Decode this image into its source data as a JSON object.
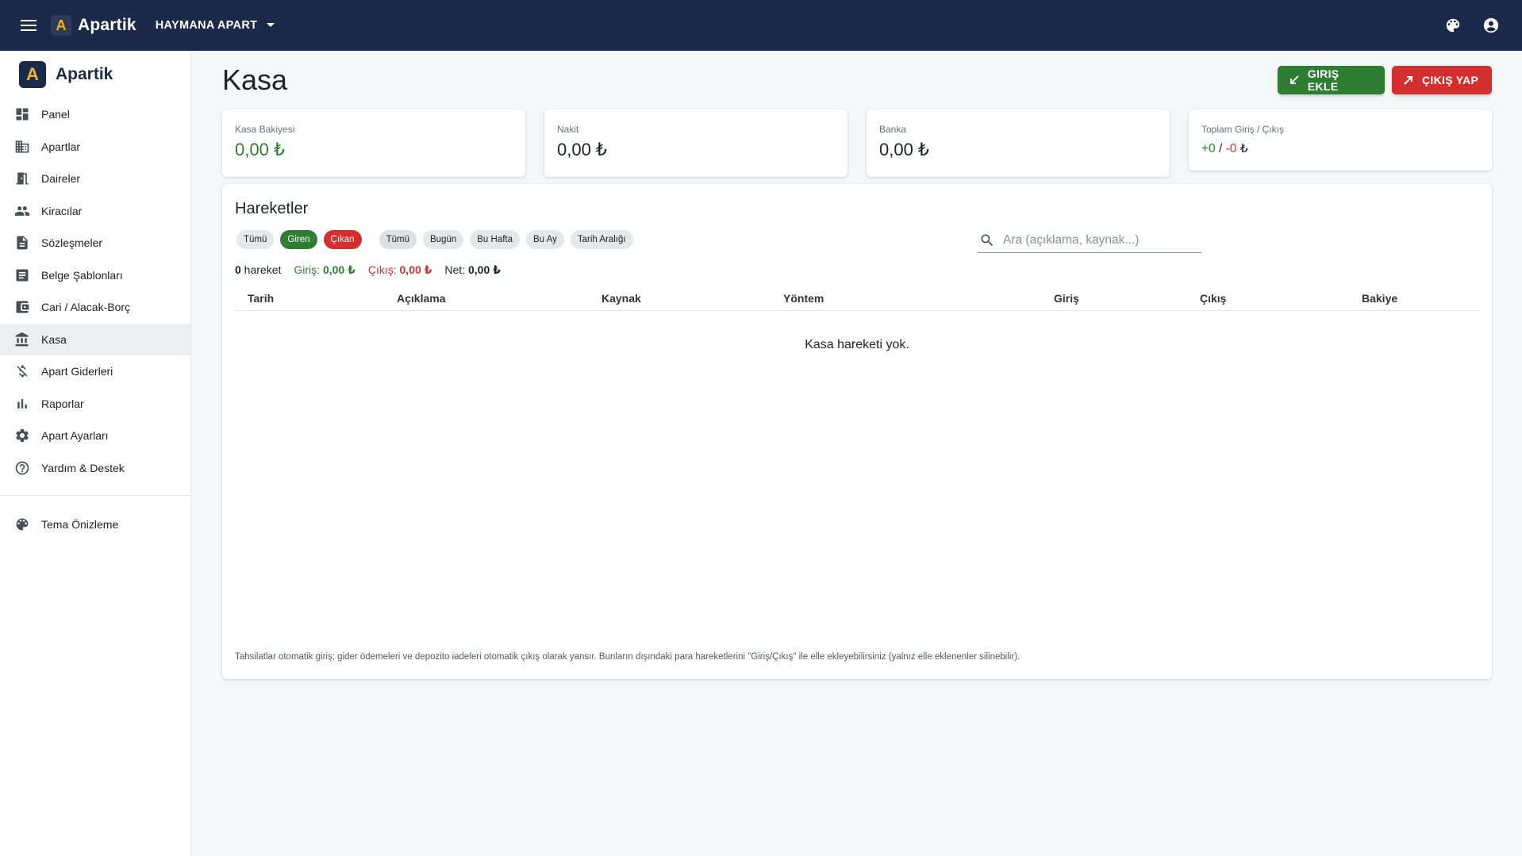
{
  "topbar": {
    "logo_letter": "A",
    "brand": "Apartik",
    "apart_name": "HAYMANA APART"
  },
  "sidebar": {
    "logo_letter": "A",
    "brand": "Apartik",
    "items": [
      {
        "label": "Panel",
        "icon": "dashboard-icon"
      },
      {
        "label": "Apartlar",
        "icon": "building-icon"
      },
      {
        "label": "Daireler",
        "icon": "door-icon"
      },
      {
        "label": "Kiracılar",
        "icon": "people-icon"
      },
      {
        "label": "Sözleşmeler",
        "icon": "document-icon"
      },
      {
        "label": "Belge Şablonları",
        "icon": "template-icon"
      },
      {
        "label": "Cari / Alacak-Borç",
        "icon": "wallet-icon"
      },
      {
        "label": "Kasa",
        "icon": "bank-icon"
      },
      {
        "label": "Apart Giderleri",
        "icon": "money-off-icon"
      },
      {
        "label": "Raporlar",
        "icon": "bar-chart-icon"
      },
      {
        "label": "Apart Ayarları",
        "icon": "gear-icon"
      },
      {
        "label": "Yardım & Destek",
        "icon": "help-icon"
      }
    ],
    "theme_preview": "Tema Önizleme",
    "active_index": 7
  },
  "page": {
    "title": "Kasa",
    "btn_in": "GIRIŞ EKLE",
    "btn_out": "ÇIKIŞ YAP"
  },
  "stats": {
    "kasa": {
      "label": "Kasa Bakiyesi",
      "value": "0,00 ₺"
    },
    "nakit": {
      "label": "Nakit",
      "value": "0,00 ₺"
    },
    "banka": {
      "label": "Banka",
      "value": "0,00 ₺"
    },
    "toplam": {
      "label": "Toplam Giriş / Çıkış",
      "in": "+0",
      "sep": " / ",
      "out": "-0",
      "currency": " ₺"
    }
  },
  "movements": {
    "title": "Hareketler",
    "type_chips": [
      "Tümü",
      "Giren",
      "Çıkan"
    ],
    "period_chips": [
      "Tümü",
      "Bugün",
      "Bu Hafta",
      "Bu Ay",
      "Tarih Aralığı"
    ],
    "search_placeholder": "Ara (açıklama, kaynak...)",
    "summary": {
      "count": "0",
      "count_label": " hareket",
      "in_label": "Giriş: ",
      "in_value": "0,00 ₺",
      "out_label": "Çıkış: ",
      "out_value": "0,00 ₺",
      "net_label": "Net: ",
      "net_value": "0,00 ₺"
    },
    "columns": [
      "Tarih",
      "Açıklama",
      "Kaynak",
      "Yöntem",
      "Giriş",
      "Çıkış",
      "Bakiye"
    ],
    "empty_text": "Kasa hareketi yok.",
    "footnote": "Tahsilatlar otomatik giriş; gider ödemeleri ve depozito iadeleri otomatik çıkış olarak yansır. Bunların dışındaki para hareketlerini \"Giriş/Çıkış\" ile elle ekleyebilirsiniz (yalnız elle eklenenler silinebilir)."
  },
  "colors": {
    "topbar": "#1b2a4a",
    "accent_yellow": "#f2b418",
    "green": "#2e7d32",
    "red": "#d32f2f"
  }
}
